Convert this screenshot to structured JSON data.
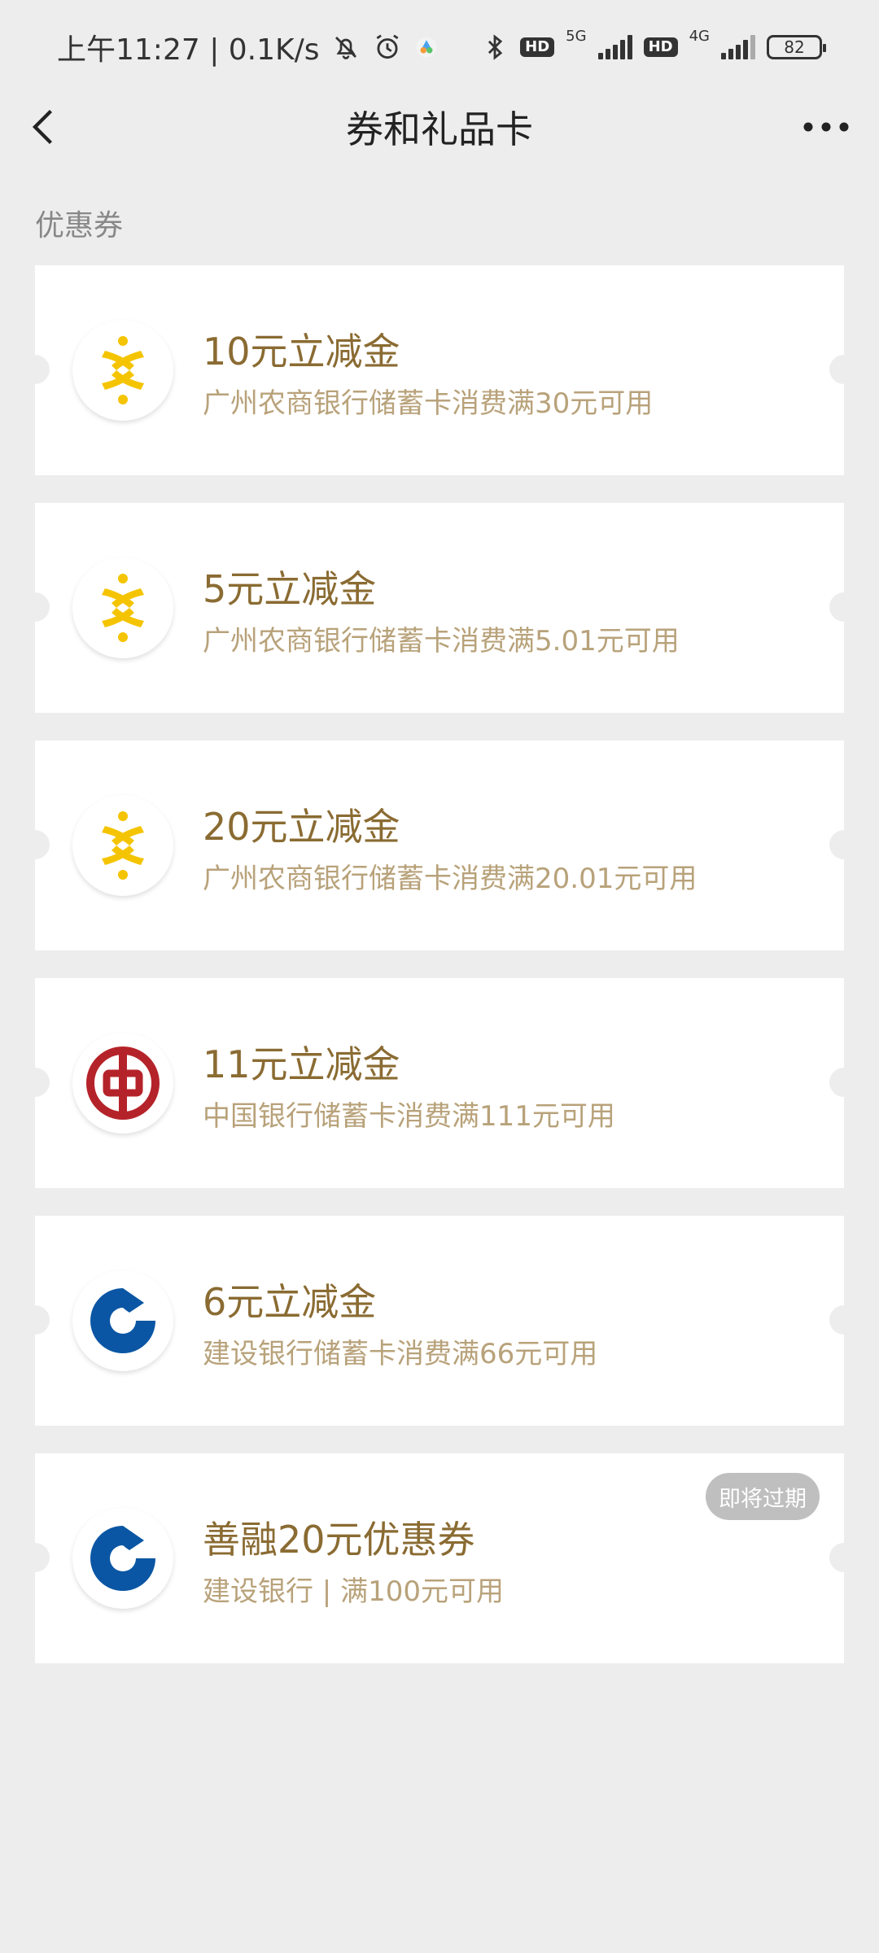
{
  "status_bar": {
    "time_text": "上午11:27 | 0.1K/s",
    "hd_1": "HD",
    "net_1": "5G",
    "hd_2": "HD",
    "net_2": "4G",
    "battery": "82"
  },
  "header": {
    "title": "券和礼品卡"
  },
  "section": {
    "label": "优惠券"
  },
  "coupons": [
    {
      "title": "10元立减金",
      "desc": "广州农商银行储蓄卡消费满30元可用",
      "bank_icon": "grcb-logo-icon"
    },
    {
      "title": "5元立减金",
      "desc": "广州农商银行储蓄卡消费满5.01元可用",
      "bank_icon": "grcb-logo-icon"
    },
    {
      "title": "20元立减金",
      "desc": "广州农商银行储蓄卡消费满20.01元可用",
      "bank_icon": "grcb-logo-icon"
    },
    {
      "title": "11元立减金",
      "desc": "中国银行储蓄卡消费满111元可用",
      "bank_icon": "boc-logo-icon"
    },
    {
      "title": "6元立减金",
      "desc": "建设银行储蓄卡消费满66元可用",
      "bank_icon": "ccb-logo-icon"
    },
    {
      "title": "善融20元优惠券",
      "desc": "建设银行 | 满100元可用",
      "bank_icon": "ccb-logo-icon",
      "badge": "即将过期"
    }
  ],
  "colors": {
    "title_gold": "#8a6b32",
    "desc_gold": "#b8a27a",
    "boc_red": "#b5232a",
    "ccb_blue": "#0a56a4",
    "grcb_yellow": "#f5c400"
  }
}
